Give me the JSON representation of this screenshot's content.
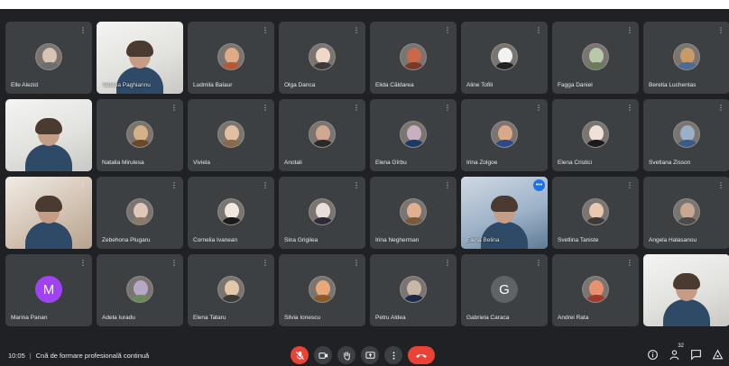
{
  "meeting": {
    "time": "10:05",
    "title": "Cnă de formare profesională continuă",
    "participant_count": "32"
  },
  "participants": [
    {
      "name": "Elle Alezid",
      "type": "photo",
      "skin": "#d8c4b4",
      "cloth": "#6d6d6d"
    },
    {
      "name": "Tatiana Paghiannu",
      "type": "video",
      "tone": "light"
    },
    {
      "name": "Ludmila Balaur",
      "type": "photo",
      "skin": "#e0aa86",
      "cloth": "#b05a3a"
    },
    {
      "name": "Olga Danca",
      "type": "photo",
      "skin": "#f0d8c8",
      "cloth": "#3a3a3a"
    },
    {
      "name": "Elida Căldarea",
      "type": "photo",
      "skin": "#c86a4a",
      "cloth": "#7a3a2a"
    },
    {
      "name": "Aline Tofili",
      "type": "photo",
      "skin": "#f2f2f2",
      "cloth": "#222222"
    },
    {
      "name": "Fagga Daniel",
      "type": "photo",
      "skin": "#b8c8a8",
      "cloth": "#6a7a5a"
    },
    {
      "name": "Beretia Luchentas",
      "type": "photo",
      "skin": "#c89a6a",
      "cloth": "#4a6a9a"
    },
    {
      "name": "",
      "type": "video",
      "tone": "light"
    },
    {
      "name": "Natalia Mirulesa",
      "type": "photo",
      "skin": "#d8b088",
      "cloth": "#6a4a2a"
    },
    {
      "name": "Viviela",
      "type": "photo",
      "skin": "#e0c0a0",
      "cloth": "#8a6a4a"
    },
    {
      "name": "Anotali",
      "type": "photo",
      "skin": "#d0a890",
      "cloth": "#2a2a2a"
    },
    {
      "name": "Elena Gîrbu",
      "type": "photo",
      "skin": "#c8b0c0",
      "cloth": "#1a3a6a"
    },
    {
      "name": "Irina Zolgoe",
      "type": "photo",
      "skin": "#d8a888",
      "cloth": "#2a4a8a"
    },
    {
      "name": "Elena Cristici",
      "type": "photo",
      "skin": "#f0e0d8",
      "cloth": "#1a1a1a"
    },
    {
      "name": "Svetlana Zisson",
      "type": "photo",
      "skin": "#9ab0c8",
      "cloth": "#3a5a8a"
    },
    {
      "name": "",
      "type": "video",
      "tone": "warm"
    },
    {
      "name": "Zebehona Plugaru",
      "type": "photo",
      "skin": "#e0c8b8",
      "cloth": "#8a7a6a"
    },
    {
      "name": "Cornelia Ivanean",
      "type": "photo",
      "skin": "#f0e8e0",
      "cloth": "#1a1a1a"
    },
    {
      "name": "Sina Grigilea",
      "type": "photo",
      "skin": "#e8e0d8",
      "cloth": "#2a2a3a"
    },
    {
      "name": "Irina Negherman",
      "type": "photo",
      "skin": "#e0b090",
      "cloth": "#7a5a3a"
    },
    {
      "name": "Elena Belina",
      "type": "video",
      "tone": "blue"
    },
    {
      "name": "Svetlina Taniste",
      "type": "photo",
      "skin": "#e8c8b0",
      "cloth": "#3a3a3a"
    },
    {
      "name": "Angela Halasanou",
      "type": "photo",
      "skin": "#c8a890",
      "cloth": "#4a4a4a"
    },
    {
      "name": "Marina Panan",
      "type": "letter",
      "letter": "M",
      "color": "#a142f4"
    },
    {
      "name": "Adela Iuradu",
      "type": "photo",
      "skin": "#b8a8c8",
      "cloth": "#6a8a5a"
    },
    {
      "name": "Elena Tataru",
      "type": "photo",
      "skin": "#e0c8a8",
      "cloth": "#3a3a3a"
    },
    {
      "name": "Silvia Ionescu",
      "type": "photo",
      "skin": "#e8a878",
      "cloth": "#8a5a2a"
    },
    {
      "name": "Petru Aldea",
      "type": "photo",
      "skin": "#c8b8a8",
      "cloth": "#1a2a4a"
    },
    {
      "name": "Gabriela Caraca",
      "type": "letter",
      "letter": "G",
      "color": "#5f6368"
    },
    {
      "name": "Andrei Rata",
      "type": "photo",
      "skin": "#e89070",
      "cloth": "#a03a2a"
    },
    {
      "name": "",
      "type": "video",
      "tone": "light"
    }
  ],
  "active_index": 21,
  "colors": {
    "background": "#202124",
    "tile": "#3c4043",
    "danger": "#ea4335",
    "accent": "#1a73e8"
  },
  "controls": [
    {
      "icon": "mic-off-icon",
      "state": "off"
    },
    {
      "icon": "camera-icon",
      "state": "on"
    },
    {
      "icon": "raise-hand-icon",
      "state": "on"
    },
    {
      "icon": "present-screen-icon",
      "state": "on"
    },
    {
      "icon": "more-options-icon",
      "state": "on"
    },
    {
      "icon": "leave-call-icon",
      "state": "leave"
    }
  ],
  "side_controls": [
    "info-icon",
    "people-icon",
    "chat-icon",
    "activities-icon"
  ]
}
